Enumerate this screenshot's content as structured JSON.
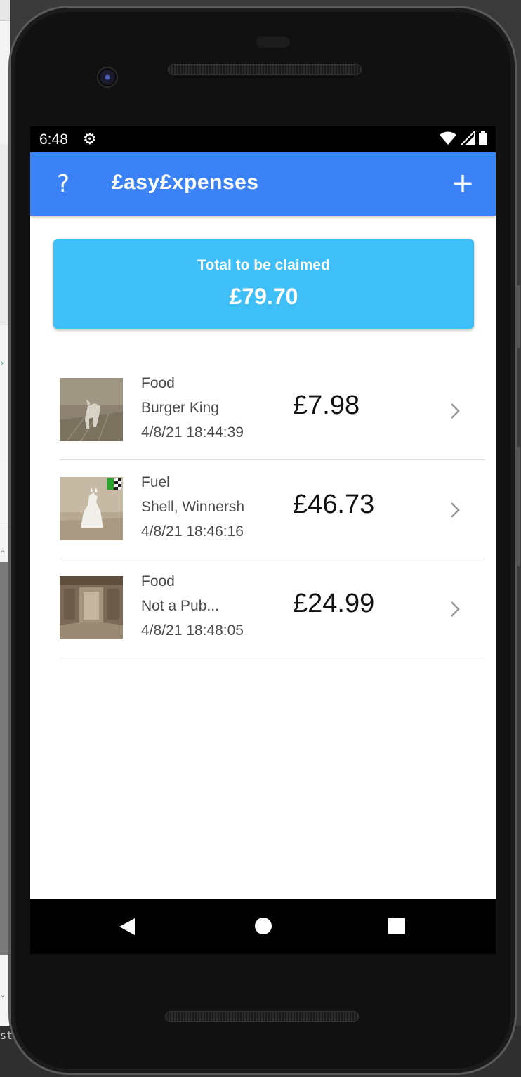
{
  "status_bar": {
    "time": "6:48",
    "settings_icon": "gear-icon",
    "wifi_icon": "wifi-icon",
    "signal_icon": "signal-icon",
    "battery_icon": "battery-icon"
  },
  "app_bar": {
    "title": "£asy£xpenses",
    "help_label": "?",
    "add_label": "+",
    "color": "#3b82f6"
  },
  "total": {
    "label": "Total to be claimed",
    "value": "£79.70",
    "color": "#3fbff8"
  },
  "expenses": [
    {
      "category": "Food",
      "vendor": "Burger King",
      "date": "4/8/21 18:44:39",
      "amount": "£7.98",
      "thumbnail": "dog-sculpture-photo"
    },
    {
      "category": "Fuel",
      "vendor": "Shell, Winnersh",
      "date": "4/8/21 18:46:16",
      "amount": "£46.73",
      "thumbnail": "white-dog-sculpture-photo"
    },
    {
      "category": "Food",
      "vendor": "Not a Pub...",
      "date": "4/8/21 18:48:05",
      "amount": "£24.99",
      "thumbnail": "room-interior-photo"
    }
  ],
  "nav": {
    "back_icon": "back-triangle-icon",
    "home_icon": "home-circle-icon",
    "recents_icon": "recents-square-icon"
  },
  "host": {
    "bottom_text": "st"
  }
}
